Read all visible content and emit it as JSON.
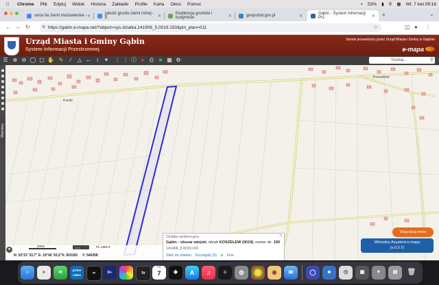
{
  "menubar": {
    "apple": "",
    "items": [
      "Chrome",
      "Plik",
      "Edytuj",
      "Widok",
      "Historia",
      "Zakładki",
      "Profile",
      "Karta",
      "Okno",
      "Pomoc"
    ],
    "battery": "53%",
    "clock": "Wt. 7 kwi 09:18"
  },
  "tabs": [
    {
      "title": "cena ha ziemi mazowieckie -"
    },
    {
      "title": "jakość gruntu ziemi rolnej - E"
    },
    {
      "title": "Ewidencja gruntów i budynków"
    },
    {
      "title": "geoportal.gov.pl"
    },
    {
      "title": "Gąbin - System Informacji Prz"
    }
  ],
  "address_bar": {
    "url": "https://gabin.e-mapa.net/?object=sys.dzialka.141906_5.0019.150&pln_plan=011"
  },
  "site": {
    "title": "Urząd Miasta i Gminy Gąbin",
    "subtitle": "System Informacji Przestrzennej",
    "service_note": "Serwis prowadzony przez Urząd Miasta i Gminy w Gąbinie",
    "brand": "e-mapa",
    "brand_colors": [
      "#e6a21d",
      "#d8501a"
    ]
  },
  "toolbar": {
    "search_placeholder": "Szukaj..."
  },
  "map": {
    "labels": {
      "kunki": "Kunki",
      "koszelew": "Koszelew"
    },
    "side_tab": "Warstwy",
    "highlight_color": "#2a2ad8",
    "scale_text": "200m",
    "projection": "PL-1992",
    "coords": {
      "n": "N: 52°23 '33,7''",
      "e": "E: 19°40 '53,2''",
      "x": "X: 503192",
      "y": "Y: 546358"
    }
  },
  "info_popup": {
    "header": "Działka ewidencyjna",
    "line_bold": "Gąbin - obszar wiejski",
    "line_mid": ", obręb ",
    "obreb": "KOSZELEW (0019)",
    "line_tail": ", numer dz. ",
    "numer": "150",
    "id": "141906_5.0019.150",
    "links": [
      "Zbliż do obiektu",
      "Szczegóły (5)",
      "Inne"
    ]
  },
  "buttons": {
    "try": "Wypróbuj mnie",
    "assistant_line1": "Wirtualny Asystent e-mapa",
    "assistant_line2": "(v.0.3.7)"
  },
  "dock": {
    "calendar_day": "7",
    "calendar_month": "KWI",
    "prime": "prime video",
    "tv": "tv"
  }
}
